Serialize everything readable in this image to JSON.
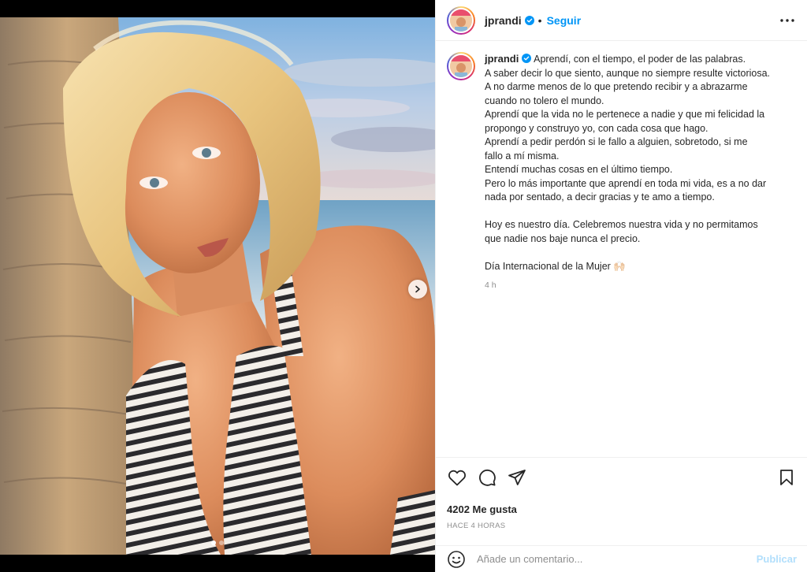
{
  "post": {
    "username": "jprandi",
    "verified": true,
    "separator": "•",
    "follow_label": "Seguir",
    "caption_lines": [
      "Aprendí, con el tiempo, el poder de las palabras.",
      "A saber decir lo que siento, aunque no siempre resulte victoriosa.",
      "A no darme menos de lo que pretendo recibir y a abrazarme",
      "cuando no tolero el mundo.",
      "Aprendí que la vida no le pertenece a nadie y que mi felicidad la",
      "propongo y construyo yo, con cada cosa que hago.",
      "Aprendí a pedir perdón si le fallo a alguien, sobretodo, si me",
      "fallo a mí misma.",
      "Entendí muchas cosas en el último tiempo.",
      "Pero lo más importante que aprendí en toda mi vida, es a no dar",
      "nada por sentado, a decir gracias y te amo a tiempo.",
      "",
      "Hoy es nuestro día. Celebremos nuestra vida y no permitamos",
      "que nadie nos baje nunca el precio.",
      "",
      "Día Internacional de la Mujer 🙌🏻"
    ],
    "caption_time": "4 h",
    "likes_text": "4202 Me gusta",
    "posted_ago": "HACE 4 HORAS",
    "comment_placeholder": "Añade un comentario...",
    "publish_label": "Publicar",
    "carousel": {
      "slides": 2,
      "current": 1
    }
  },
  "icons": {
    "like": "heart-icon",
    "comment": "comment-icon",
    "share": "share-icon",
    "save": "bookmark-icon",
    "more": "more-options-icon",
    "emoji": "emoji-icon",
    "next": "chevron-right-icon"
  },
  "colors": {
    "accent": "#0095f6",
    "publish_disabled": "#b2dffc",
    "muted": "#8e8e8e",
    "text": "#262626"
  }
}
